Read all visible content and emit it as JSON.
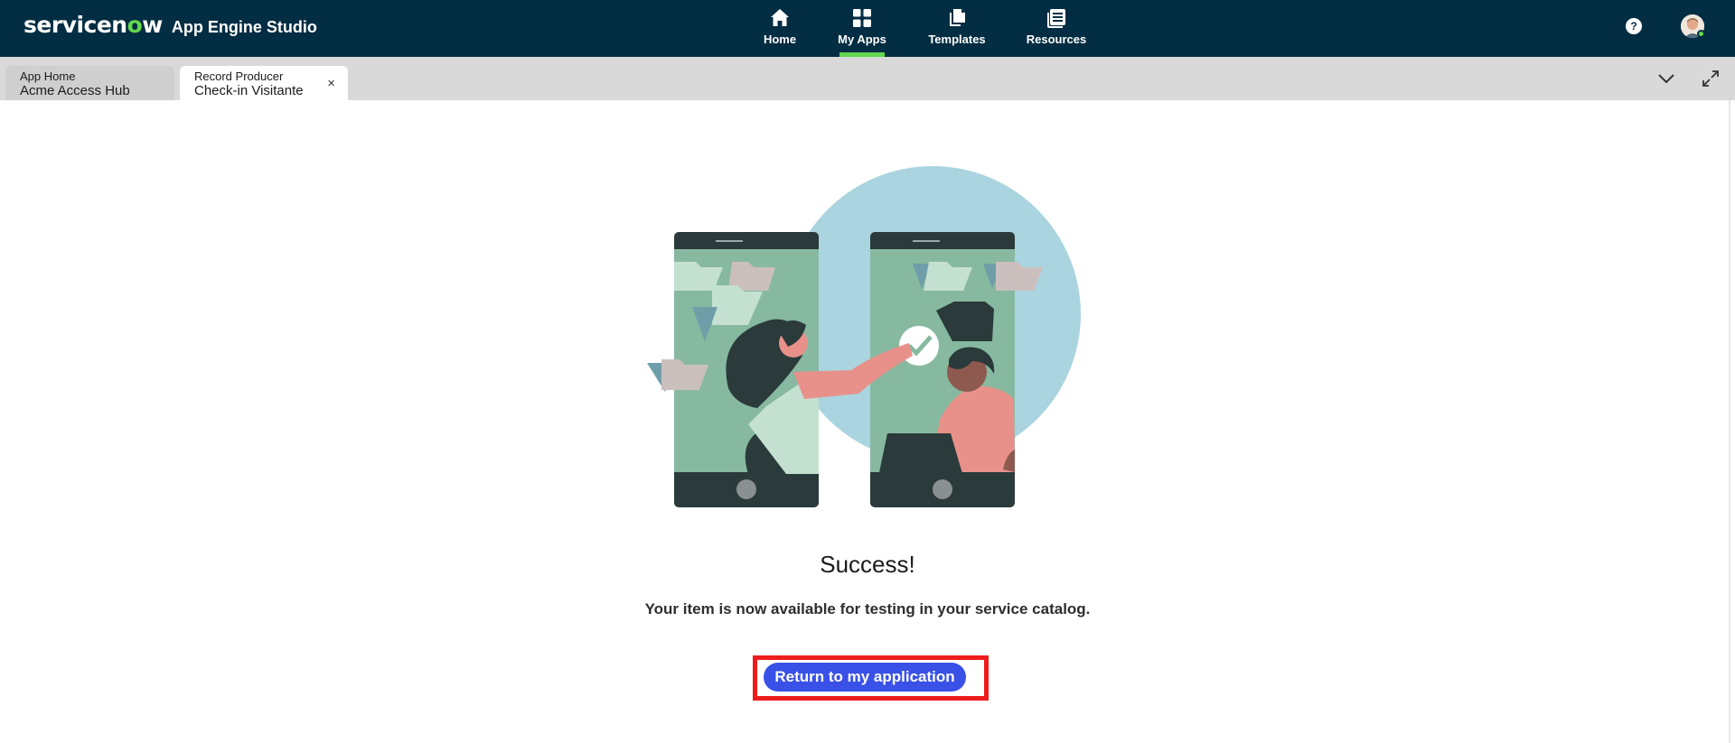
{
  "header": {
    "brand_logo": "servicenow",
    "app_title": "App Engine Studio",
    "nav": [
      {
        "label": "Home",
        "icon": "home-icon",
        "active": false
      },
      {
        "label": "My Apps",
        "icon": "grid-icon",
        "active": true
      },
      {
        "label": "Templates",
        "icon": "templates-icon",
        "active": false
      },
      {
        "label": "Resources",
        "icon": "resources-icon",
        "active": false
      }
    ],
    "help_label": "?",
    "accent_color": "#62d84e",
    "bg_color": "#032d42"
  },
  "tabs": [
    {
      "type": "App Home",
      "name": "Acme Access Hub",
      "active": false
    },
    {
      "type": "Record Producer",
      "name": "Check-in Visitante",
      "active": true,
      "close": "×"
    }
  ],
  "main": {
    "title": "Success!",
    "message": "Your item is now available for testing in your service catalog.",
    "primary_button": "Return to my application",
    "button_color": "#3951e6",
    "highlight_color": "#ee1c1c"
  }
}
